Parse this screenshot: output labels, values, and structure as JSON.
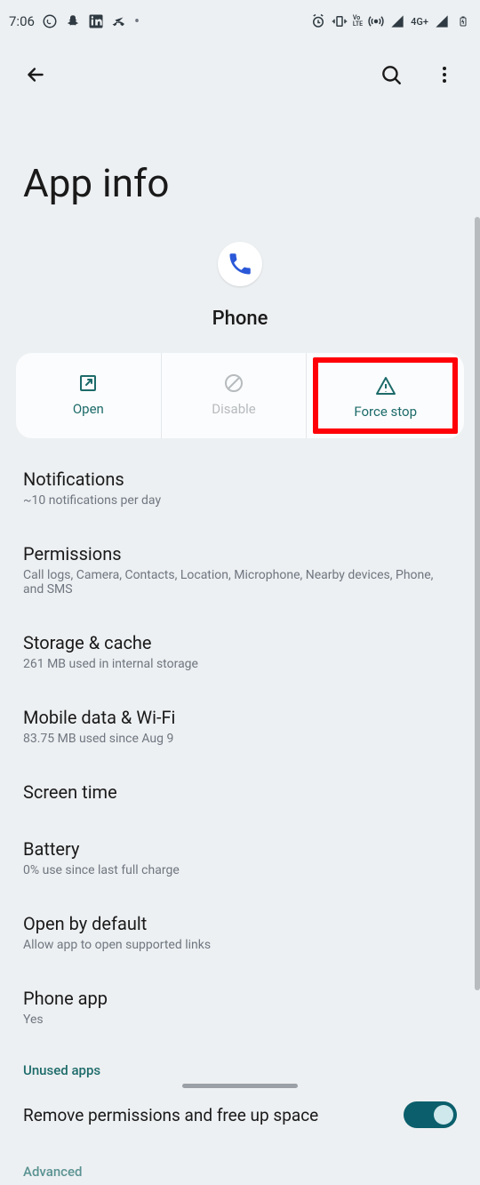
{
  "statusbar": {
    "time": "7:06",
    "network_label": "4G+",
    "lte_label": "Vo\nLTE"
  },
  "page": {
    "title": "App info"
  },
  "app": {
    "name": "Phone"
  },
  "actions": {
    "open": "Open",
    "disable": "Disable",
    "force_stop": "Force stop"
  },
  "settings": [
    {
      "title": "Notifications",
      "sub": "~10 notifications per day"
    },
    {
      "title": "Permissions",
      "sub": "Call logs, Camera, Contacts, Location, Microphone, Nearby devices, Phone, and SMS"
    },
    {
      "title": "Storage & cache",
      "sub": "261 MB used in internal storage"
    },
    {
      "title": "Mobile data & Wi-Fi",
      "sub": "83.75 MB used since Aug 9"
    },
    {
      "title": "Screen time",
      "sub": ""
    },
    {
      "title": "Battery",
      "sub": "0% use since last full charge"
    },
    {
      "title": "Open by default",
      "sub": "Allow app to open supported links"
    },
    {
      "title": "Phone app",
      "sub": "Yes"
    }
  ],
  "section": {
    "unused_apps": "Unused apps",
    "remove_permissions": "Remove permissions and free up space",
    "advanced": "Advanced"
  }
}
